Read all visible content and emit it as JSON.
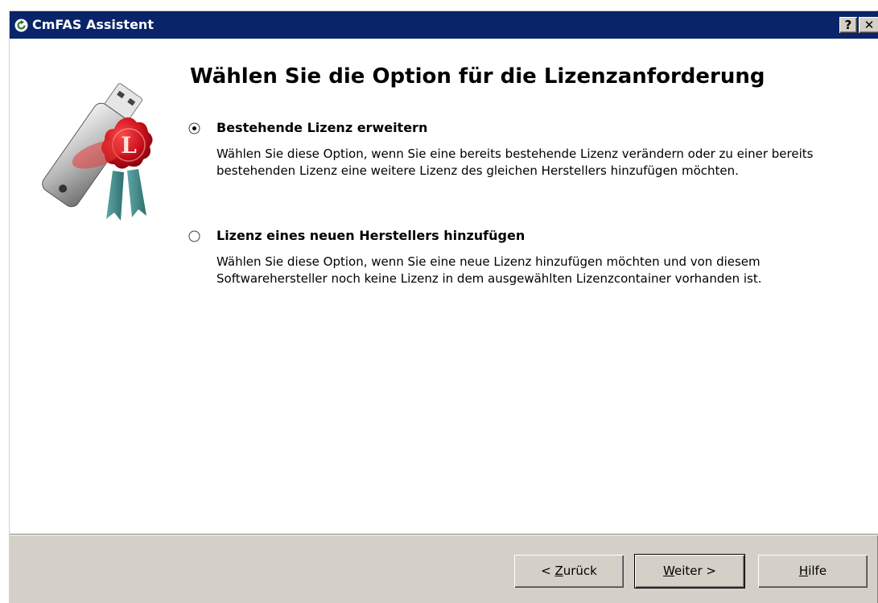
{
  "window": {
    "title": "CmFAS Assistent",
    "help_button": "?",
    "close_button": "✕"
  },
  "page": {
    "heading": "Wählen Sie die Option für die Lizenzanforderung"
  },
  "options": [
    {
      "label": "Bestehende Lizenz erweitern",
      "selected": true,
      "description": "Wählen Sie diese Option, wenn Sie eine bereits bestehende Lizenz verändern oder zu einer bereits bestehenden Lizenz eine weitere Lizenz des gleichen Herstellers hinzufügen möchten."
    },
    {
      "label": "Lizenz eines neuen Herstellers hinzufügen",
      "selected": false,
      "description": "Wählen Sie diese Option, wenn Sie eine neue Lizenz hinzufügen möchten und von diesem Softwarehersteller noch keine Lizenz in dem ausgewählten Lizenzcontainer vorhanden ist."
    }
  ],
  "buttons": {
    "back": {
      "prefix": "< ",
      "mnemonic": "Z",
      "rest": "urück"
    },
    "next": {
      "mnemonic": "W",
      "rest": "eiter >"
    },
    "help": {
      "mnemonic": "H",
      "rest": "ilfe"
    }
  },
  "icons": {
    "app": "refresh-icon",
    "logo": "usb-license-dongle-icon",
    "logo_letter": "L"
  },
  "colors": {
    "titlebar": "#0a246a",
    "dialog_bg": "#d4d0c8",
    "seal_red": "#c8101a"
  }
}
